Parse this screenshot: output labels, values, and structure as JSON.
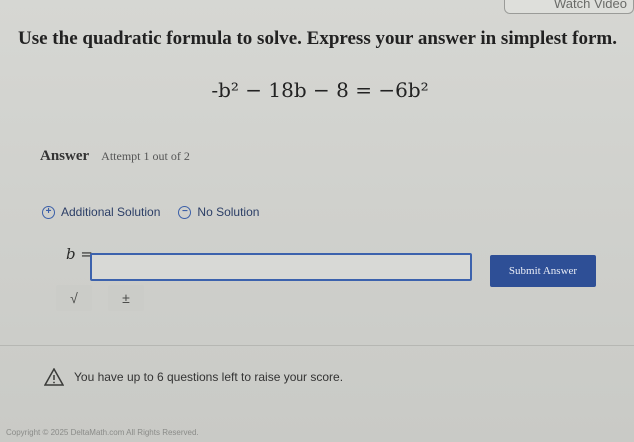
{
  "header": {
    "watch_video_label": "Watch Video"
  },
  "question": {
    "prompt": "Use the quadratic formula to solve. Express your answer in simplest form.",
    "equation": "-b² − 18b − 8 = −6b²"
  },
  "answer": {
    "label": "Answer",
    "attempt": "Attempt 1 out of 2"
  },
  "options": {
    "additional_solution": "Additional Solution",
    "no_solution": "No Solution"
  },
  "input": {
    "variable_label": "b =",
    "value": ""
  },
  "buttons": {
    "submit": "Submit Answer"
  },
  "tools": {
    "sqrt": "√",
    "plus_minus": "±"
  },
  "notice": {
    "text": "You have up to 6 questions left to raise your score."
  },
  "footer": {
    "copyright": "Copyright © 2025 DeltaMath.com All Rights Reserved."
  }
}
